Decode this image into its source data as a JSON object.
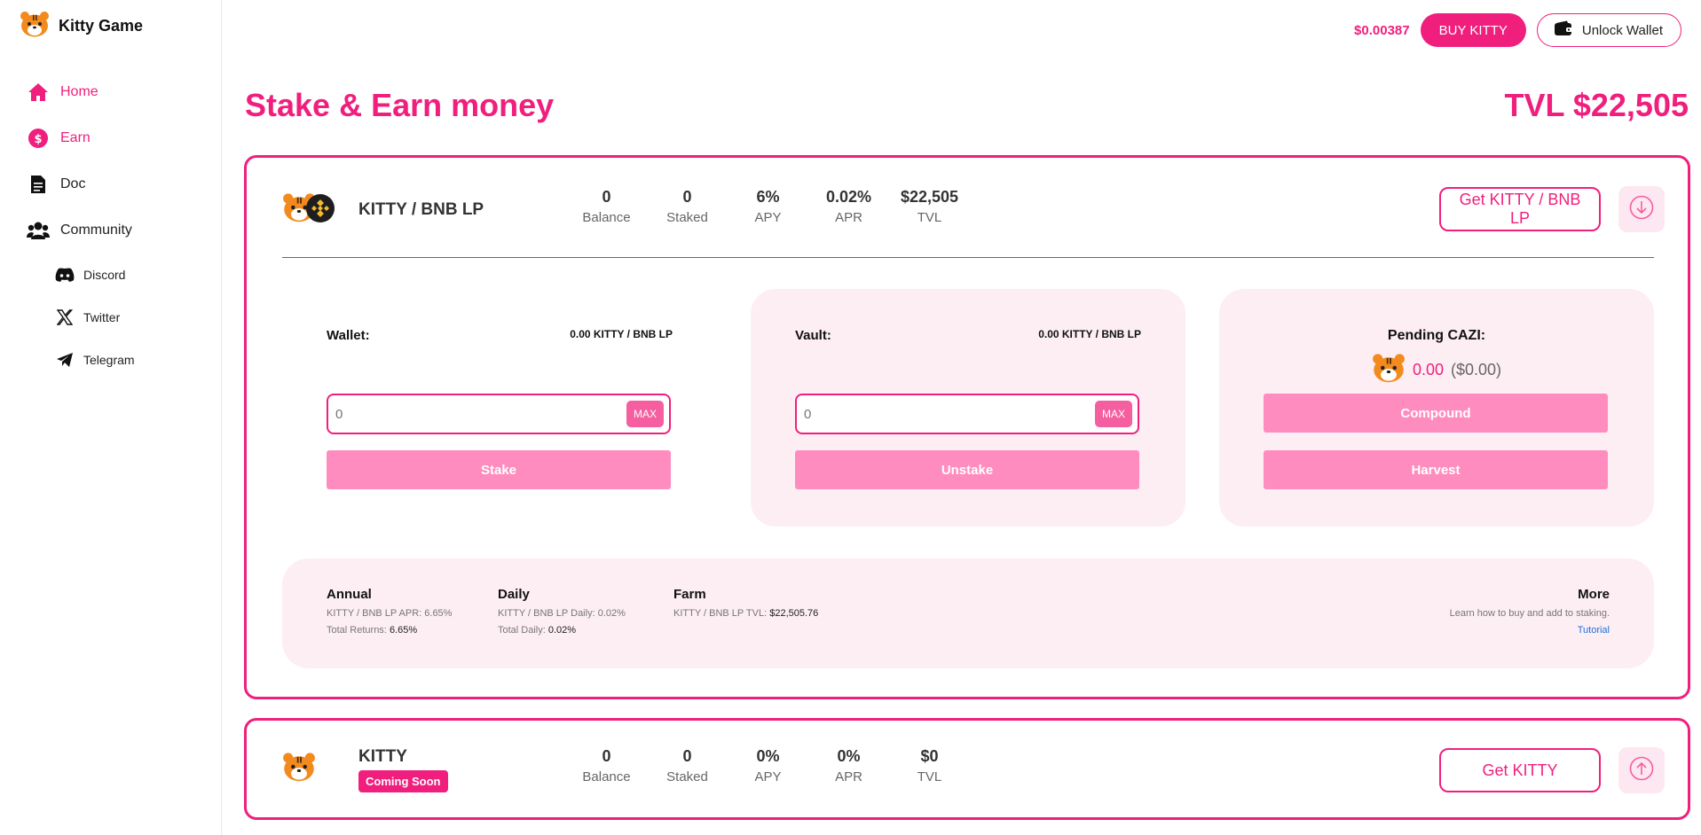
{
  "app": {
    "name": "Kitty Game"
  },
  "sidebar": {
    "items": [
      {
        "label": "Home"
      },
      {
        "label": "Earn"
      },
      {
        "label": "Doc"
      },
      {
        "label": "Community"
      }
    ],
    "community": [
      {
        "label": "Discord"
      },
      {
        "label": "Twitter"
      },
      {
        "label": "Telegram"
      }
    ]
  },
  "header": {
    "price": "$0.00387",
    "buy_label": "BUY KITTY",
    "wallet_label": "Unlock Wallet"
  },
  "page": {
    "title": "Stake & Earn money",
    "tvl": "TVL $22,505"
  },
  "pools": [
    {
      "name": "KITTY / BNB LP",
      "stats": [
        {
          "value": "0",
          "label": "Balance"
        },
        {
          "value": "0",
          "label": "Staked"
        },
        {
          "value": "6%",
          "label": "APY"
        },
        {
          "value": "0.02%",
          "label": "APR"
        },
        {
          "value": "$22,505",
          "label": "TVL"
        }
      ],
      "get_label": "Get KITTY / BNB LP",
      "wallet": {
        "label": "Wallet:",
        "amount": "0.00 KITTY / BNB LP",
        "input_placeholder": "0",
        "max_label": "MAX",
        "button": "Stake"
      },
      "vault": {
        "label": "Vault:",
        "amount": "0.00 KITTY / BNB LP",
        "input_placeholder": "0",
        "max_label": "MAX",
        "button": "Unstake"
      },
      "pending": {
        "label": "Pending CAZI:",
        "amount": "0.00",
        "usd": "($0.00)",
        "compound_label": "Compound",
        "harvest_label": "Harvest"
      },
      "info": {
        "annual": {
          "title": "Annual",
          "apr_label": "KITTY / BNB LP APR:",
          "apr_value": "6.65%",
          "returns_label": "Total Returns:",
          "returns_value": "6.65%"
        },
        "daily": {
          "title": "Daily",
          "daily_label": "KITTY / BNB LP Daily:",
          "daily_value": "0.02%",
          "total_label": "Total Daily:",
          "total_value": "0.02%"
        },
        "farm": {
          "title": "Farm",
          "tvl_label": "KITTY / BNB LP TVL:",
          "tvl_value": "$22,505.76"
        },
        "more": {
          "title": "More",
          "text": "Learn how to buy and add to staking.",
          "link": "Tutorial"
        }
      }
    },
    {
      "name": "KITTY",
      "badge": "Coming Soon",
      "stats": [
        {
          "value": "0",
          "label": "Balance"
        },
        {
          "value": "0",
          "label": "Staked"
        },
        {
          "value": "0%",
          "label": "APY"
        },
        {
          "value": "0%",
          "label": "APR"
        },
        {
          "value": "$0",
          "label": "TVL"
        }
      ],
      "get_label": "Get KITTY"
    }
  ],
  "colors": {
    "accent": "#f01f7d",
    "panel_bg": "#fdeef4",
    "button_soft": "#ff8cbe"
  }
}
